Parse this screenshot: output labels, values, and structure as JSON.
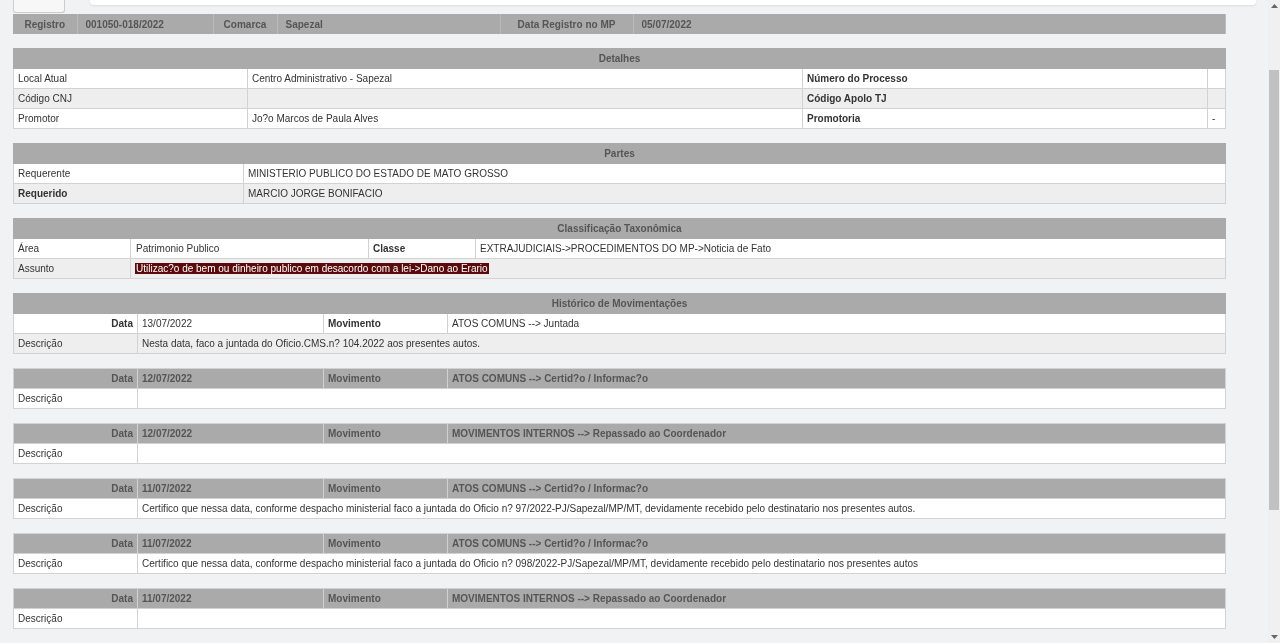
{
  "summary": [
    {
      "label": "Registro",
      "value": "001050-018/2022"
    },
    {
      "label": "Comarca",
      "value": "Sapezal"
    },
    {
      "label": "Data Registro no MP",
      "value": "05/07/2022"
    }
  ],
  "detalhes": {
    "title": "Detalhes",
    "rows": [
      {
        "label": "Local Atual",
        "value": "Centro Administrativo - Sapezal",
        "label_2": "Número do Processo"
      },
      {
        "label": "Código CNJ",
        "label_2": "Código Apolo TJ"
      },
      {
        "label": "Promotor",
        "value": "Jo?o Marcos de Paula Alves",
        "label_2": "Promotoria",
        "value_2": "-"
      }
    ]
  },
  "partes": {
    "title": "Partes",
    "rows": [
      {
        "label": "Requerente",
        "value": "MINISTERIO PUBLICO DO ESTADO DE MATO GROSSO",
        "emphasized": false
      },
      {
        "label": "Requerido",
        "value": "MARCIO JORGE BONIFACIO",
        "emphasized": true
      }
    ]
  },
  "classificacao": {
    "title": "Classificação Taxonômica",
    "rows": [
      {
        "label": "Área",
        "value": "Patrimonio Publico",
        "label_2": "Classe",
        "value_2": "EXTRAJUDICIAIS->PROCEDIMENTOS DO MP->Noticia de Fato",
        "highlighted": false
      },
      {
        "label": "Assunto",
        "value": "Utilizac?o de bem ou dinheiro publico em desacordo com a lei->Dano ao Erario",
        "highlighted": true
      }
    ]
  },
  "historico": {
    "title": "Histórico de Movimentações",
    "entries": [
      {
        "kind": "latest",
        "date_label": "Data",
        "date": "13/07/2022",
        "movement_label": "Movimento",
        "movement": "ATOS COMUNS --> Juntada",
        "description_label": "Descrição",
        "description": "Nesta data, faco a juntada do Oficio.CMS.n? 104.2022 aos presentes autos."
      },
      {
        "kind": "previous",
        "date_label": "Data",
        "date": "12/07/2022",
        "movement_label": "Movimento",
        "movement": "ATOS COMUNS --> Certid?o / Informac?o",
        "description_label": "Descrição"
      },
      {
        "kind": "previous",
        "date_label": "Data",
        "date": "12/07/2022",
        "movement_label": "Movimento",
        "movement": "MOVIMENTOS INTERNOS --> Repassado ao Coordenador",
        "description_label": "Descrição"
      },
      {
        "kind": "previous",
        "date_label": "Data",
        "date": "11/07/2022",
        "movement_label": "Movimento",
        "movement": "ATOS COMUNS --> Certid?o / Informac?o",
        "description_label": "Descrição",
        "description": "Certifico que nessa data, conforme despacho ministerial faco a juntada do Oficio n? 97/2022-PJ/Sapezal/MP/MT, devidamente recebido pelo destinatario nos presentes autos."
      },
      {
        "kind": "previous",
        "date_label": "Data",
        "date": "11/07/2022",
        "movement_label": "Movimento",
        "movement": "ATOS COMUNS --> Certid?o / Informac?o",
        "description_label": "Descrição",
        "description": "Certifico que nessa data, conforme despacho ministerial faco a juntada do Oficio n? 098/2022-PJ/Sapezal/MP/MT, devidamente recebido pelo destinatario nos presentes autos"
      },
      {
        "kind": "previous",
        "date_label": "Data",
        "date": "11/07/2022",
        "movement_label": "Movimento",
        "movement": "MOVIMENTOS INTERNOS --> Repassado ao Coordenador",
        "description_label": "Descrição"
      }
    ]
  }
}
